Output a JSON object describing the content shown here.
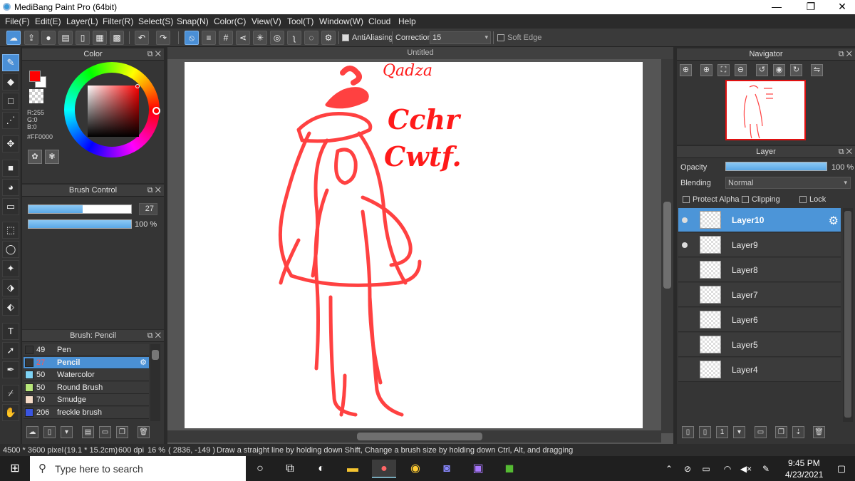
{
  "window": {
    "title": "MediBang Paint Pro (64bit)",
    "min": "—",
    "max": "❐",
    "close": "✕"
  },
  "menu": [
    "File(F)",
    "Edit(E)",
    "Layer(L)",
    "Filter(R)",
    "Select(S)",
    "Snap(N)",
    "Color(C)",
    "View(V)",
    "Tool(T)",
    "Window(W)",
    "Cloud",
    "Help"
  ],
  "toolbar": {
    "antialiasing": "AntiAliasing",
    "correction_label": "Correction",
    "correction_value": "15",
    "soft_edge": "Soft Edge"
  },
  "color_panel": {
    "title": "Color",
    "r": "R:255",
    "g": "G:0",
    "b": "B:0",
    "hex": "#FF0000",
    "fg_color": "#ff0000",
    "bg_color": "#ffffff"
  },
  "brush_control": {
    "title": "Brush Control",
    "size": "27",
    "size_fraction": 0.53,
    "opacity": "100 %",
    "opacity_fraction": 1.0
  },
  "brush_panel": {
    "title": "Brush: Pencil",
    "brushes": [
      {
        "size": "49",
        "name": "Pen",
        "color": "#333333"
      },
      {
        "size": "27",
        "name": "Pencil",
        "color": "#333333"
      },
      {
        "size": "50",
        "name": "Watercolor",
        "color": "#7fd3f5"
      },
      {
        "size": "50",
        "name": "Round Brush",
        "color": "#b8e67a"
      },
      {
        "size": "70",
        "name": "Smudge",
        "color": "#f6dcc8"
      },
      {
        "size": "206",
        "name": "freckle brush",
        "color": "#3a55e0"
      }
    ]
  },
  "canvas": {
    "tab": "Untitled",
    "scribbles": [
      "Qadza",
      "Cchr",
      "Cwtf."
    ]
  },
  "navigator": {
    "title": "Navigator"
  },
  "layer_panel": {
    "title": "Layer",
    "opacity_label": "Opacity",
    "opacity_value": "100 %",
    "opacity_fraction": 1.0,
    "blending_label": "Blending",
    "blending_value": "Normal",
    "protect_alpha": "Protect Alpha",
    "clipping": "Clipping",
    "lock": "Lock",
    "layers": [
      "Layer10",
      "Layer9",
      "Layer8",
      "Layer7",
      "Layer6",
      "Layer5",
      "Layer4"
    ]
  },
  "status": {
    "size": "4500 * 3600 pixel",
    "cm": "(19.1 * 15.2cm)",
    "dpi": "600 dpi",
    "zoom": "16 %",
    "coords": "( 2836, -149 )",
    "hint": "Draw a straight line by holding down Shift, Change a brush size by holding down Ctrl, Alt, and dragging"
  },
  "taskbar": {
    "search_placeholder": "Type here to search",
    "time": "9:45 PM",
    "date": "4/23/2021"
  }
}
